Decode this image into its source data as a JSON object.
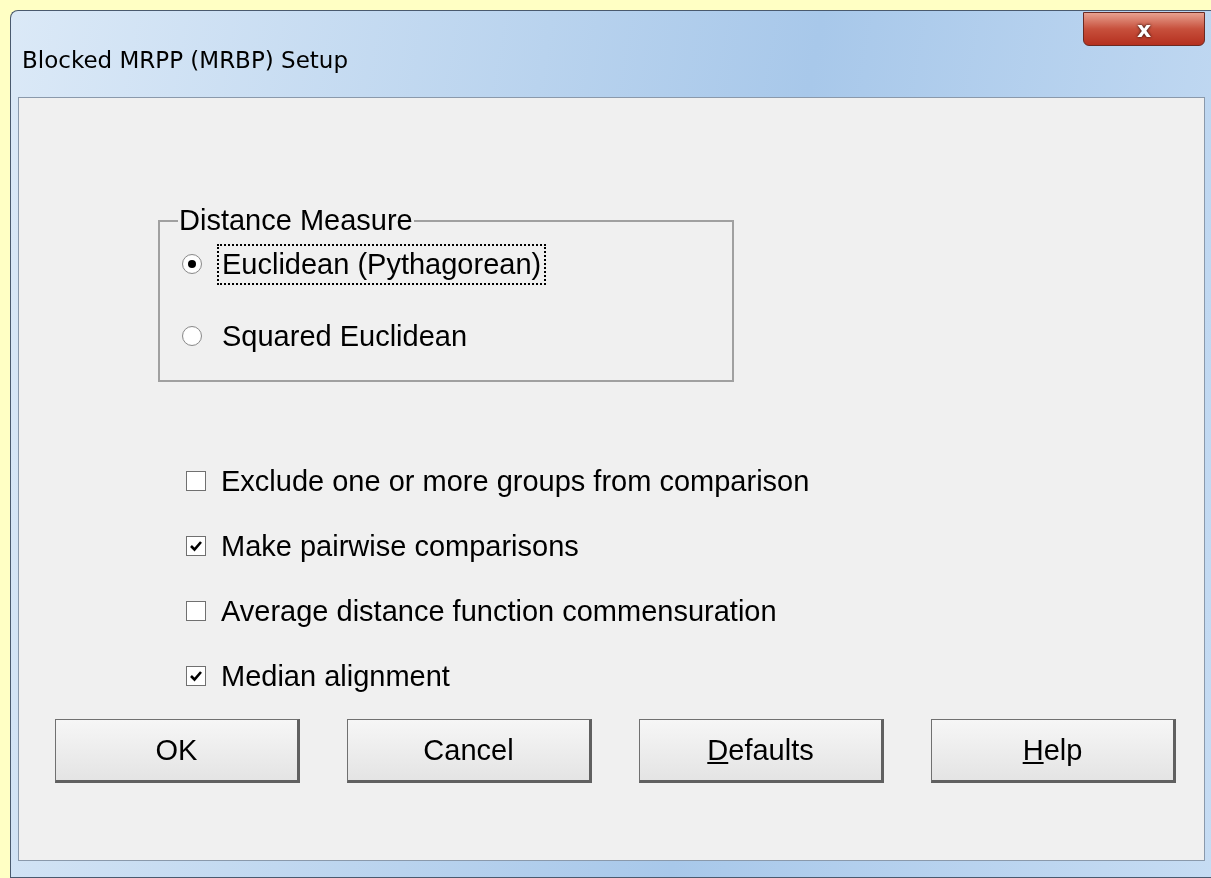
{
  "window": {
    "title": "Blocked MRPP (MRBP) Setup",
    "close": "x"
  },
  "distance_measure": {
    "label": "Distance Measure",
    "options": [
      {
        "label": "Euclidean (Pythagorean)",
        "selected": true,
        "focused": true
      },
      {
        "label": "Squared Euclidean",
        "selected": false,
        "focused": false
      }
    ]
  },
  "options": [
    {
      "label": "Exclude one or more groups from comparison",
      "checked": false
    },
    {
      "label": "Make pairwise comparisons",
      "checked": true
    },
    {
      "label": "Average distance function commensuration",
      "checked": false
    },
    {
      "label": "Median alignment",
      "checked": true
    }
  ],
  "buttons": [
    {
      "label": "OK",
      "underline_first": false
    },
    {
      "label": "Cancel",
      "underline_first": false
    },
    {
      "label": "Defaults",
      "underline_first": true
    },
    {
      "label": "Help",
      "underline_first": true
    }
  ]
}
